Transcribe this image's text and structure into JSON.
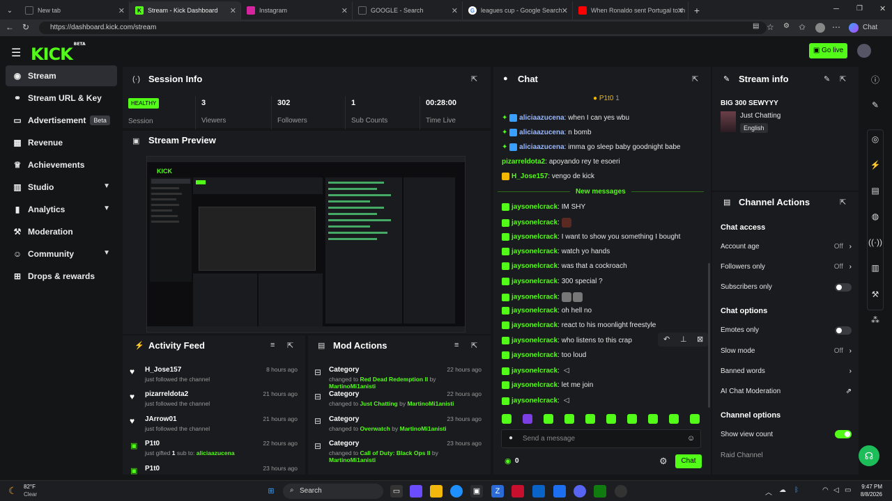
{
  "browser": {
    "tabs": [
      {
        "label": "New tab",
        "active": false
      },
      {
        "label": "Stream - Kick Dashboard",
        "active": true
      },
      {
        "label": "Instagram",
        "active": false
      },
      {
        "label": "GOOGLE - Search",
        "active": false
      },
      {
        "label": "leagues cup - Google Search",
        "active": false
      },
      {
        "label": "When Ronaldo sent Portugal to th",
        "active": false
      }
    ],
    "url": "https://dashboard.kick.com/stream",
    "copilot_label": "Chat"
  },
  "header": {
    "logo": "KICK",
    "logo_sup": "BETA",
    "go_live": "Go live"
  },
  "sidebar": {
    "items": [
      {
        "label": "Stream",
        "icon": "broadcast-icon",
        "active": true
      },
      {
        "label": "Stream URL & Key",
        "icon": "link-icon"
      },
      {
        "label": "Advertisement",
        "icon": "ad-icon",
        "badge": "Beta"
      },
      {
        "label": "Revenue",
        "icon": "revenue-icon"
      },
      {
        "label": "Achievements",
        "icon": "trophy-icon"
      },
      {
        "label": "Studio",
        "icon": "studio-icon",
        "expandable": true
      },
      {
        "label": "Analytics",
        "icon": "analytics-icon",
        "expandable": true
      },
      {
        "label": "Moderation",
        "icon": "hammer-icon"
      },
      {
        "label": "Community",
        "icon": "community-icon",
        "expandable": true
      },
      {
        "label": "Drops & rewards",
        "icon": "gift-icon"
      }
    ]
  },
  "session": {
    "title": "Session Info",
    "status": "HEALTHY",
    "session_label": "Session",
    "stats": [
      {
        "value": "3",
        "label": "Viewers"
      },
      {
        "value": "302",
        "label": "Followers"
      },
      {
        "value": "1",
        "label": "Sub Counts"
      },
      {
        "value": "00:28:00",
        "label": "Time Live"
      }
    ]
  },
  "preview": {
    "title": "Stream Preview"
  },
  "chat": {
    "title": "Chat",
    "pinned_user": "P1t0",
    "pinned_count": "1",
    "messages_before": [
      {
        "user": "aliciaazucena",
        "text": "when I can yes wbu",
        "color": "#9ab8ff"
      },
      {
        "user": "aliciaazucena",
        "text": "n bomb",
        "color": "#9ab8ff"
      },
      {
        "user": "aliciaazucena",
        "text": "imma go sleep baby goodnight babe",
        "color": "#9ab8ff"
      },
      {
        "user": "pizarreldota2",
        "text": "apoyando rey te esoeri",
        "color": "#53fc18"
      },
      {
        "user": "H_Jose157",
        "text": "vengo de kick",
        "color": "#53fc18"
      }
    ],
    "new_messages_label": "New messages",
    "messages_after": [
      {
        "user": "jaysonelcrack",
        "text": "IM SHY"
      },
      {
        "user": "jaysonelcrack",
        "text": ""
      },
      {
        "user": "jaysonelcrack",
        "text": "I want to show you something I bought"
      },
      {
        "user": "jaysonelcrack",
        "text": "watch yo hands"
      },
      {
        "user": "jaysonelcrack",
        "text": "was that a cockroach"
      },
      {
        "user": "jaysonelcrack",
        "text": "300 special ?"
      },
      {
        "user": "jaysonelcrack",
        "text": ""
      },
      {
        "user": "jaysonelcrack",
        "text": "oh hell no"
      },
      {
        "user": "jaysonelcrack",
        "text": "react to his moonlight freestyle"
      },
      {
        "user": "jaysonelcrack",
        "text": "who listens to this crap"
      },
      {
        "user": "jaysonelcrack",
        "text": "too loud"
      },
      {
        "user": "jaysonelcrack",
        "text": ""
      },
      {
        "user": "jaysonelcrack",
        "text": "let me join"
      },
      {
        "user": "jaysonelcrack",
        "text": ""
      }
    ],
    "input_placeholder": "Send a message",
    "points": "0",
    "send_label": "Chat"
  },
  "stream_info": {
    "title": "Stream info",
    "stream_title": "BIG 300 SEWYYY",
    "category": "Just Chatting",
    "language": "English"
  },
  "channel_actions": {
    "title": "Channel Actions",
    "chat_access": "Chat access",
    "account_age": {
      "label": "Account age",
      "value": "Off"
    },
    "followers_only": {
      "label": "Followers only",
      "value": "Off"
    },
    "subscribers_only": {
      "label": "Subscribers only",
      "on": false
    },
    "chat_options": "Chat options",
    "emotes_only": {
      "label": "Emotes only",
      "on": false
    },
    "slow_mode": {
      "label": "Slow mode",
      "value": "Off"
    },
    "banned_words": "Banned words",
    "ai_moderation": "AI Chat Moderation",
    "channel_options": "Channel options",
    "show_view_count": {
      "label": "Show view count",
      "on": true
    },
    "raid_channel": "Raid Channel"
  },
  "activity": {
    "title": "Activity Feed",
    "items": [
      {
        "name": "H_Jose157",
        "desc": "just followed the channel",
        "time": "8 hours ago",
        "icon": "heart-icon"
      },
      {
        "name": "pizarreldota2",
        "desc": "just followed the channel",
        "time": "21 hours ago",
        "icon": "heart-icon"
      },
      {
        "name": "JArrow01",
        "desc": "just followed the channel",
        "time": "21 hours ago",
        "icon": "heart-icon"
      },
      {
        "name": "P1t0",
        "desc_pre": "just gifted ",
        "desc_count": "1",
        "desc_mid": " sub to: ",
        "desc_user": "aliciaazucena",
        "time": "22 hours ago",
        "icon": "gift-icon"
      },
      {
        "name": "P1t0",
        "desc": "",
        "time": "23 hours ago",
        "icon": "gift-icon"
      }
    ]
  },
  "mod_actions": {
    "title": "Mod Actions",
    "items": [
      {
        "title": "Category",
        "time": "22 hours ago",
        "pre": "changed to ",
        "game": "Red Dead Redemption II",
        "by": " by ",
        "mod": "MartinoMi1anisti"
      },
      {
        "title": "Category",
        "time": "22 hours ago",
        "pre": "changed to ",
        "game": "Just Chatting",
        "by": " by ",
        "mod": "MartinoMi1anisti"
      },
      {
        "title": "Category",
        "time": "23 hours ago",
        "pre": "changed to ",
        "game": "Overwatch",
        "by": " by ",
        "mod": "MartinoMi1anisti"
      },
      {
        "title": "Category",
        "time": "23 hours ago",
        "pre": "changed to ",
        "game": "Call of Duty: Black Ops II",
        "by": " by ",
        "mod": "MartinoMi1anisti"
      }
    ]
  },
  "taskbar": {
    "weather_temp": "82°F",
    "weather_desc": "Clear",
    "search": "Search",
    "time": "9:47 PM",
    "date": "8/8/2026"
  }
}
